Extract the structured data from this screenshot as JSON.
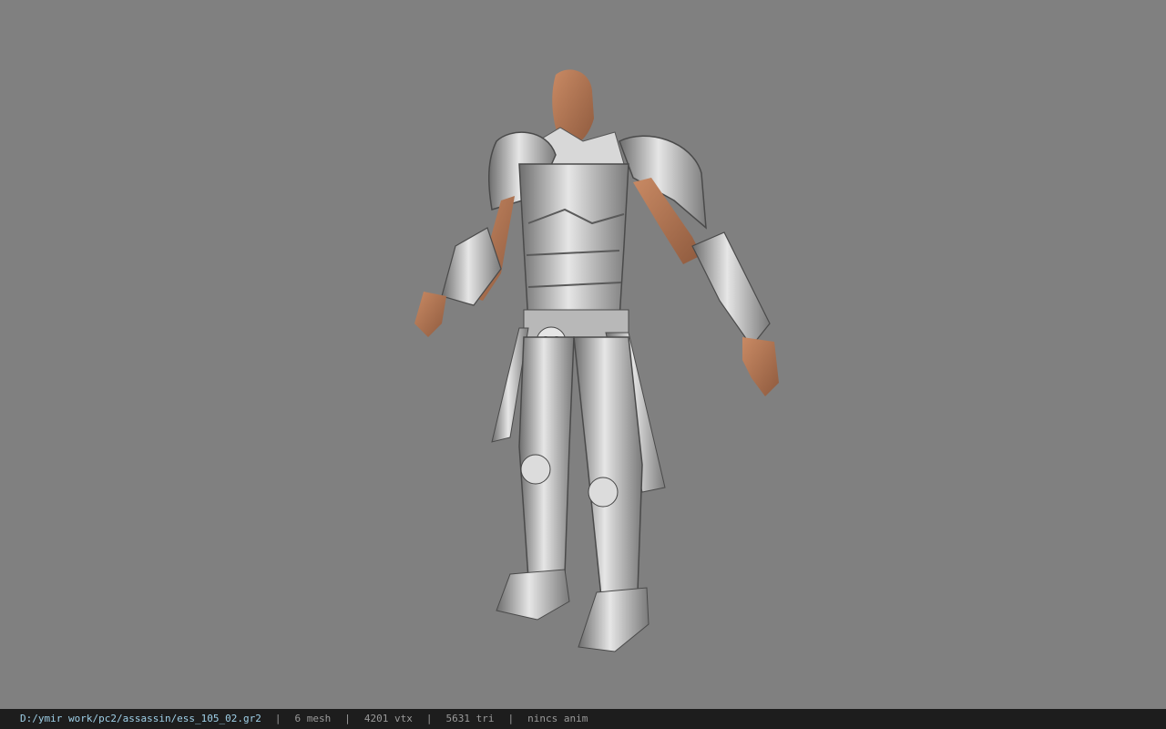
{
  "viewer": {
    "background_color": "#808080",
    "model_subject": "armored-character-model"
  },
  "status": {
    "file_path": "D:/ymir work/pc2/assassin/ess_105_02.gr2",
    "separator": "|",
    "mesh_count": "6 mesh",
    "vertex_count": "4201 vtx",
    "triangle_count": "5631 tri",
    "anim_info": "nincs anim"
  }
}
